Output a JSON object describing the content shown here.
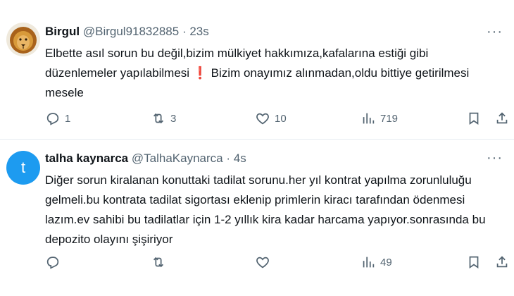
{
  "tweets": [
    {
      "name": "Birgul",
      "handle": "@Birgul91832885",
      "time": "23s",
      "text_before": "Elbette asıl sorun bu değil,bizim mülkiyet hakkımıza,kafalarına estiği gibi düzenlemeler yapılabilmesi",
      "emoji": "❗",
      "text_after": " Bizim onayımız alınmadan,oldu bittiye getirilmesi mesele",
      "replies": "1",
      "retweets": "3",
      "likes": "10",
      "views": "719",
      "avatar": "lion-avatar"
    },
    {
      "name": "talha kaynarca",
      "handle": "@TalhaKaynarca",
      "time": "4s",
      "avatar_letter": "t",
      "text": "Diğer sorun kiralanan konuttaki tadilat sorunu.her yıl kontrat yapılma zorunluluğu gelmeli.bu kontrata tadilat sigortası eklenip primlerin kiracı tarafından ödenmesi lazım.ev sahibi bu tadilatlar için 1-2 yıllık kira kadar harcama yapıyor.sonrasında bu depozito olayını şişiriyor",
      "replies": "",
      "retweets": "",
      "likes": "",
      "views": "49"
    }
  ],
  "separator": "·",
  "more_label": "···",
  "colors": {
    "text": "#0f1419",
    "muted": "#536471",
    "accent": "#1d9bf0",
    "exclamation": "#e0245e"
  }
}
